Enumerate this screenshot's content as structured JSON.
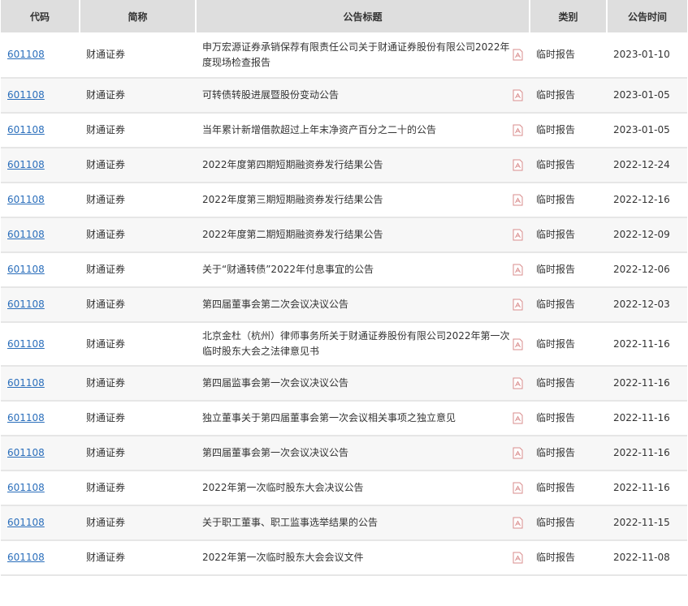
{
  "headers": [
    "代码",
    "简称",
    "公告标题",
    "类别",
    "公告时间"
  ],
  "accent": "#2a6ebb",
  "rows": [
    {
      "code": "601108",
      "name": "财通证券",
      "title": "申万宏源证券承销保荐有限责任公司关于财通证券股份有限公司2022年度现场检查报告",
      "type": "临时报告",
      "date": "2023-01-10"
    },
    {
      "code": "601108",
      "name": "财通证券",
      "title": "可转债转股进展暨股份变动公告",
      "type": "临时报告",
      "date": "2023-01-05"
    },
    {
      "code": "601108",
      "name": "财通证券",
      "title": "当年累计新增借款超过上年末净资产百分之二十的公告",
      "type": "临时报告",
      "date": "2023-01-05"
    },
    {
      "code": "601108",
      "name": "财通证券",
      "title": "2022年度第四期短期融资券发行结果公告",
      "type": "临时报告",
      "date": "2022-12-24"
    },
    {
      "code": "601108",
      "name": "财通证券",
      "title": "2022年度第三期短期融资券发行结果公告",
      "type": "临时报告",
      "date": "2022-12-16"
    },
    {
      "code": "601108",
      "name": "财通证券",
      "title": "2022年度第二期短期融资券发行结果公告",
      "type": "临时报告",
      "date": "2022-12-09"
    },
    {
      "code": "601108",
      "name": "财通证券",
      "title": "关于“财通转债”2022年付息事宜的公告",
      "type": "临时报告",
      "date": "2022-12-06"
    },
    {
      "code": "601108",
      "name": "财通证券",
      "title": "第四届董事会第二次会议决议公告",
      "type": "临时报告",
      "date": "2022-12-03"
    },
    {
      "code": "601108",
      "name": "财通证券",
      "title": "北京金杜（杭州）律师事务所关于财通证券股份有限公司2022年第一次临时股东大会之法律意见书",
      "type": "临时报告",
      "date": "2022-11-16"
    },
    {
      "code": "601108",
      "name": "财通证券",
      "title": "第四届监事会第一次会议决议公告",
      "type": "临时报告",
      "date": "2022-11-16"
    },
    {
      "code": "601108",
      "name": "财通证券",
      "title": "独立董事关于第四届董事会第一次会议相关事项之独立意见",
      "type": "临时报告",
      "date": "2022-11-16"
    },
    {
      "code": "601108",
      "name": "财通证券",
      "title": "第四届董事会第一次会议决议公告",
      "type": "临时报告",
      "date": "2022-11-16"
    },
    {
      "code": "601108",
      "name": "财通证券",
      "title": "2022年第一次临时股东大会决议公告",
      "type": "临时报告",
      "date": "2022-11-16"
    },
    {
      "code": "601108",
      "name": "财通证券",
      "title": "关于职工董事、职工监事选举结果的公告",
      "type": "临时报告",
      "date": "2022-11-15"
    },
    {
      "code": "601108",
      "name": "财通证券",
      "title": "2022年第一次临时股东大会会议文件",
      "type": "临时报告",
      "date": "2022-11-08"
    }
  ]
}
